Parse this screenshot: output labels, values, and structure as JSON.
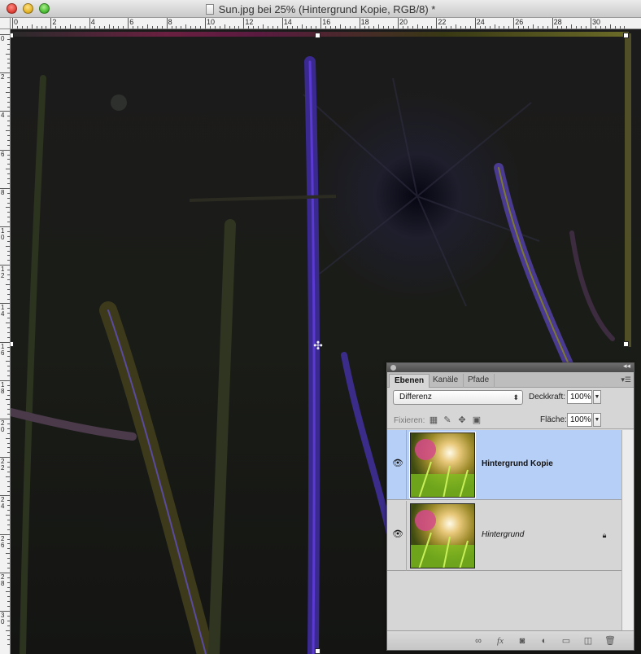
{
  "window": {
    "title": "Sun.jpg bei 25% (Hintergrund Kopie, RGB/8) *"
  },
  "rulers": {
    "top_labels": [
      "0",
      "2",
      "4",
      "6",
      "8",
      "10",
      "12",
      "14",
      "16",
      "18",
      "20",
      "22",
      "24",
      "26",
      "28",
      "30"
    ],
    "left_labels": [
      "0",
      "2",
      "4",
      "6",
      "8",
      "10",
      "12",
      "14",
      "16",
      "18",
      "20",
      "22",
      "24",
      "26",
      "28",
      "30"
    ]
  },
  "icons": {
    "close": "close-button",
    "minimize": "minimize-button",
    "zoom": "zoom-button",
    "document": "document-icon",
    "eye": "eye-icon",
    "lock": "lock-icon"
  },
  "layers_panel": {
    "tabs": [
      {
        "label": "Ebenen",
        "active": true
      },
      {
        "label": "Kanäle",
        "active": false
      },
      {
        "label": "Pfade",
        "active": false
      }
    ],
    "blend_mode": "Differenz",
    "opacity_label": "Deckkraft:",
    "opacity_value": "100%",
    "lock_label": "Fixieren:",
    "fill_label": "Fläche:",
    "fill_value": "100%",
    "layers": [
      {
        "name": "Hintergrund Kopie",
        "selected": true,
        "visible": true,
        "locked": false
      },
      {
        "name": "Hintergrund",
        "selected": false,
        "visible": true,
        "locked": true
      }
    ]
  }
}
